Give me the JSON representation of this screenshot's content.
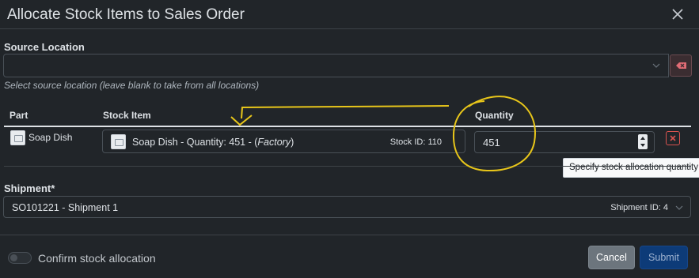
{
  "dialog": {
    "title": "Allocate Stock Items to Sales Order"
  },
  "source_location": {
    "label": "Source Location",
    "value": "",
    "help": "Select source location (leave blank to take from all locations)"
  },
  "table": {
    "headers": [
      "Part",
      "Stock Item",
      "Quantity"
    ],
    "row": {
      "part": "Soap Dish",
      "stock_item_prefix": "Soap Dish - Quantity: 451 - (",
      "stock_item_location": "Factory",
      "stock_item_suffix": ")",
      "stock_id": "Stock ID: 110",
      "quantity": "451"
    }
  },
  "tooltip": "Specify stock allocation quantity",
  "shipment": {
    "label": "Shipment*",
    "value": "SO101221 - Shipment 1",
    "shipment_id": "Shipment ID: 4"
  },
  "footer": {
    "confirm_label": "Confirm stock allocation",
    "cancel_label": "Cancel",
    "submit_label": "Submit"
  },
  "icons": {
    "close": "close-icon",
    "clear": "clear-icon",
    "chevron": "chevron-down-icon",
    "delete": "delete-row-icon",
    "thumbnail": "image-thumbnail-icon"
  },
  "colors": {
    "background": "#212529",
    "accent_submit": "#0d3b78",
    "danger": "#d9534f",
    "annotation": "#e8c61a"
  }
}
